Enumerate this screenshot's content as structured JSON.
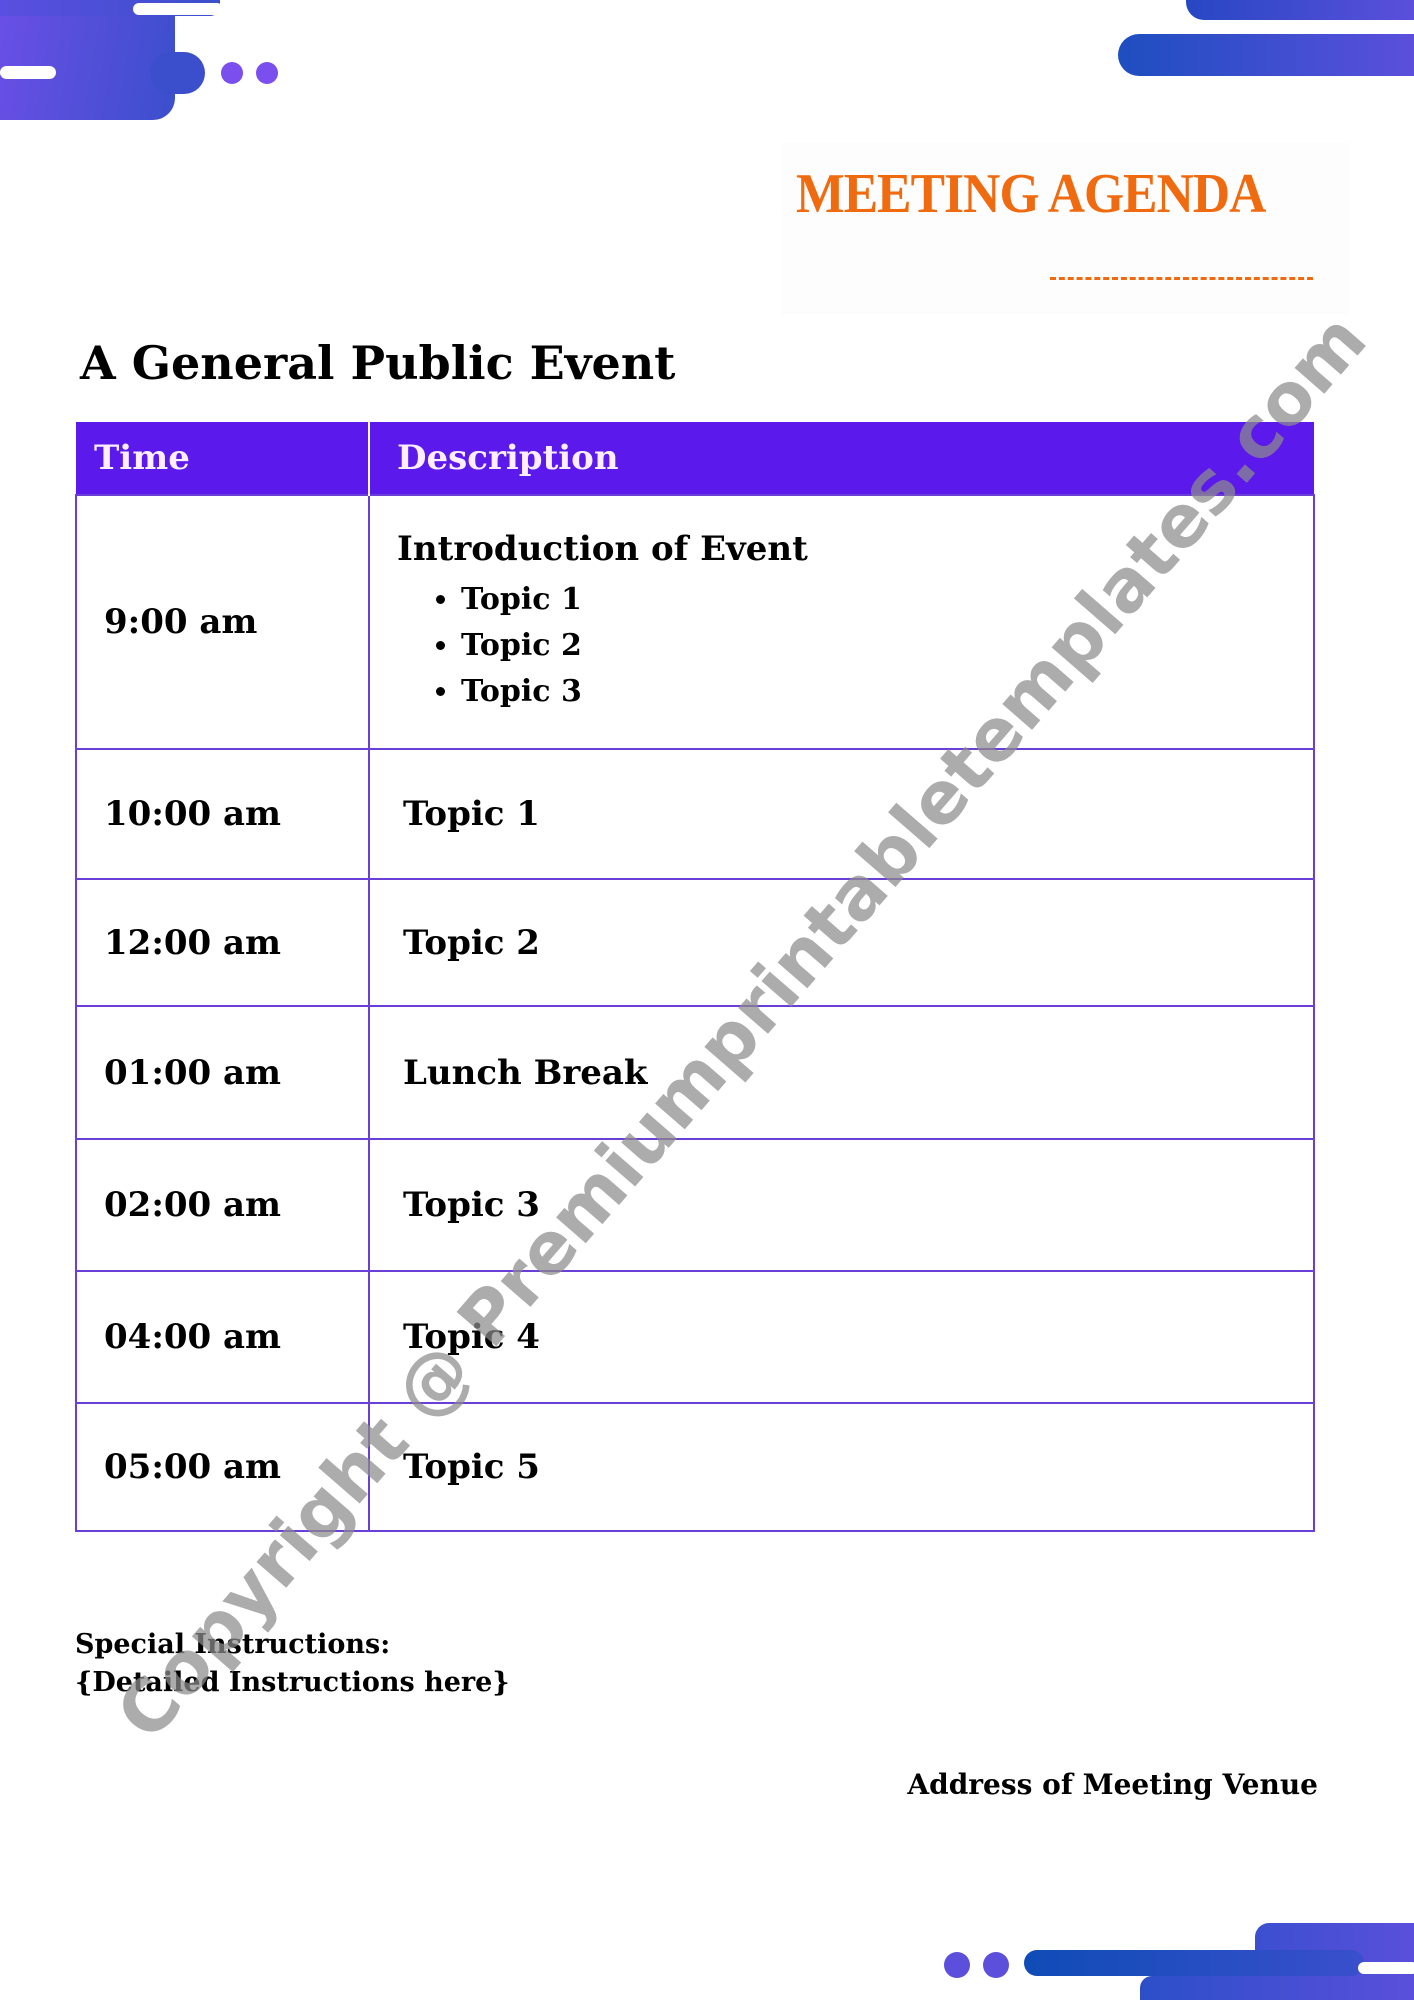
{
  "header": {
    "title": "MEETING AGENDA",
    "title_color": "#f06a10",
    "accent_color": "#5b19ec"
  },
  "event": {
    "title": "A General Public Event"
  },
  "table": {
    "columns": [
      "Time",
      "Description"
    ],
    "intro": {
      "time": "9:00 am",
      "heading": "Introduction of Event",
      "topics": [
        "Topic 1",
        "Topic 2",
        "Topic 3"
      ]
    },
    "rows": [
      {
        "time": "10:00 am",
        "description": "Topic 1"
      },
      {
        "time": "12:00 am",
        "description": "Topic 2"
      },
      {
        "time": "01:00 am",
        "description": "Lunch Break"
      },
      {
        "time": "02:00 am",
        "description": "Topic 3"
      },
      {
        "time": "04:00 am",
        "description": "Topic 4"
      },
      {
        "time": "05:00 am",
        "description": "Topic 5"
      }
    ]
  },
  "instructions": {
    "label": "Special Instructions:",
    "text": "{Detailed Instructions here}"
  },
  "footer": {
    "address": "Address of Meeting Venue"
  },
  "watermark": "Copyright @ Premiumprintabletemplates.com"
}
